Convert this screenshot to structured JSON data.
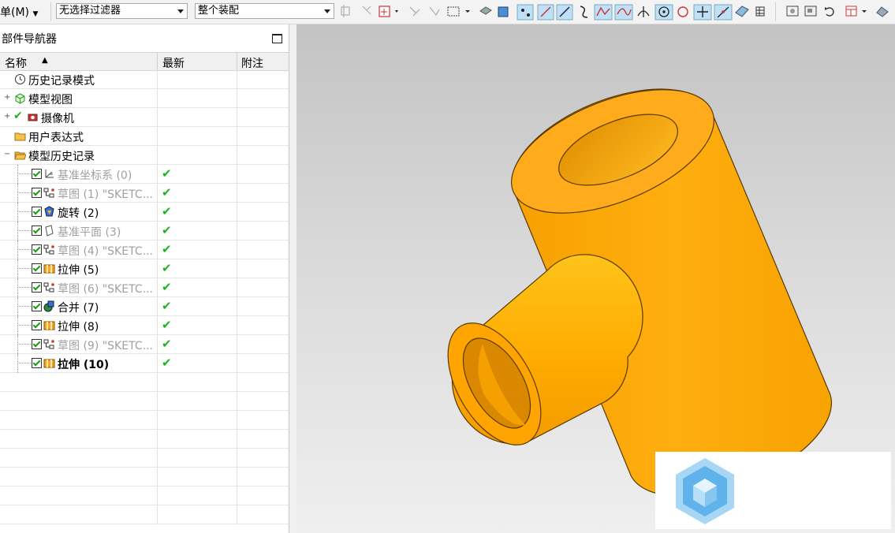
{
  "toolbar": {
    "menu_label": "菜单(M)",
    "filter_select": "无选择过滤器",
    "assembly_select": "整个装配"
  },
  "navigator": {
    "title": "部件导航器",
    "columns": [
      "名称",
      "最新",
      "附注"
    ],
    "rows": [
      {
        "label": "历史记录模式",
        "style": "normal",
        "icon": "clock-icon",
        "expander": "",
        "checkbox": false,
        "latest": false
      },
      {
        "label": "模型视图",
        "style": "normal",
        "icon": "model-view-icon",
        "expander": "+",
        "checkbox": false,
        "latest": false
      },
      {
        "label": "摄像机",
        "style": "normal",
        "icon": "camera-icon",
        "expander": "+",
        "checkbox": false,
        "latest": false,
        "checkmark": true
      },
      {
        "label": "用户表达式",
        "style": "normal",
        "icon": "folder-icon",
        "expander": "",
        "checkbox": false,
        "latest": false
      },
      {
        "label": "模型历史记录",
        "style": "normal",
        "icon": "folder-open-icon",
        "expander": "-",
        "checkbox": false,
        "latest": false
      },
      {
        "label": "基准坐标系 (0)",
        "style": "grey",
        "icon": "datum-csys-icon",
        "expander": "",
        "checkbox": true,
        "latest": true
      },
      {
        "label": "草图 (1) \"SKETC...",
        "style": "grey",
        "icon": "sketch-icon",
        "expander": "",
        "checkbox": true,
        "latest": true
      },
      {
        "label": "旋转 (2)",
        "style": "normal",
        "icon": "revolve-icon",
        "expander": "",
        "checkbox": true,
        "latest": true
      },
      {
        "label": "基准平面 (3)",
        "style": "grey",
        "icon": "datum-plane-icon",
        "expander": "",
        "checkbox": true,
        "latest": true
      },
      {
        "label": "草图 (4) \"SKETC...",
        "style": "grey",
        "icon": "sketch-icon",
        "expander": "",
        "checkbox": true,
        "latest": true
      },
      {
        "label": "拉伸 (5)",
        "style": "normal",
        "icon": "extrude-icon",
        "expander": "",
        "checkbox": true,
        "latest": true
      },
      {
        "label": "草图 (6) \"SKETC...",
        "style": "grey",
        "icon": "sketch-icon",
        "expander": "",
        "checkbox": true,
        "latest": true
      },
      {
        "label": "合并 (7)",
        "style": "normal",
        "icon": "unite-icon",
        "expander": "",
        "checkbox": true,
        "latest": true
      },
      {
        "label": "拉伸 (8)",
        "style": "normal",
        "icon": "extrude-icon",
        "expander": "",
        "checkbox": true,
        "latest": true
      },
      {
        "label": "草图 (9) \"SKETC...",
        "style": "grey",
        "icon": "sketch-icon",
        "expander": "",
        "checkbox": true,
        "latest": true
      },
      {
        "label": "拉伸 (10)",
        "style": "bold",
        "icon": "extrude-icon",
        "expander": "",
        "checkbox": true,
        "latest": true
      }
    ],
    "empty_rows": 8
  },
  "colors": {
    "part_orange": "#ffa500",
    "part_dark": "#b86e00",
    "check_green": "#22b022",
    "logo_blue": "#5fb3ea"
  }
}
